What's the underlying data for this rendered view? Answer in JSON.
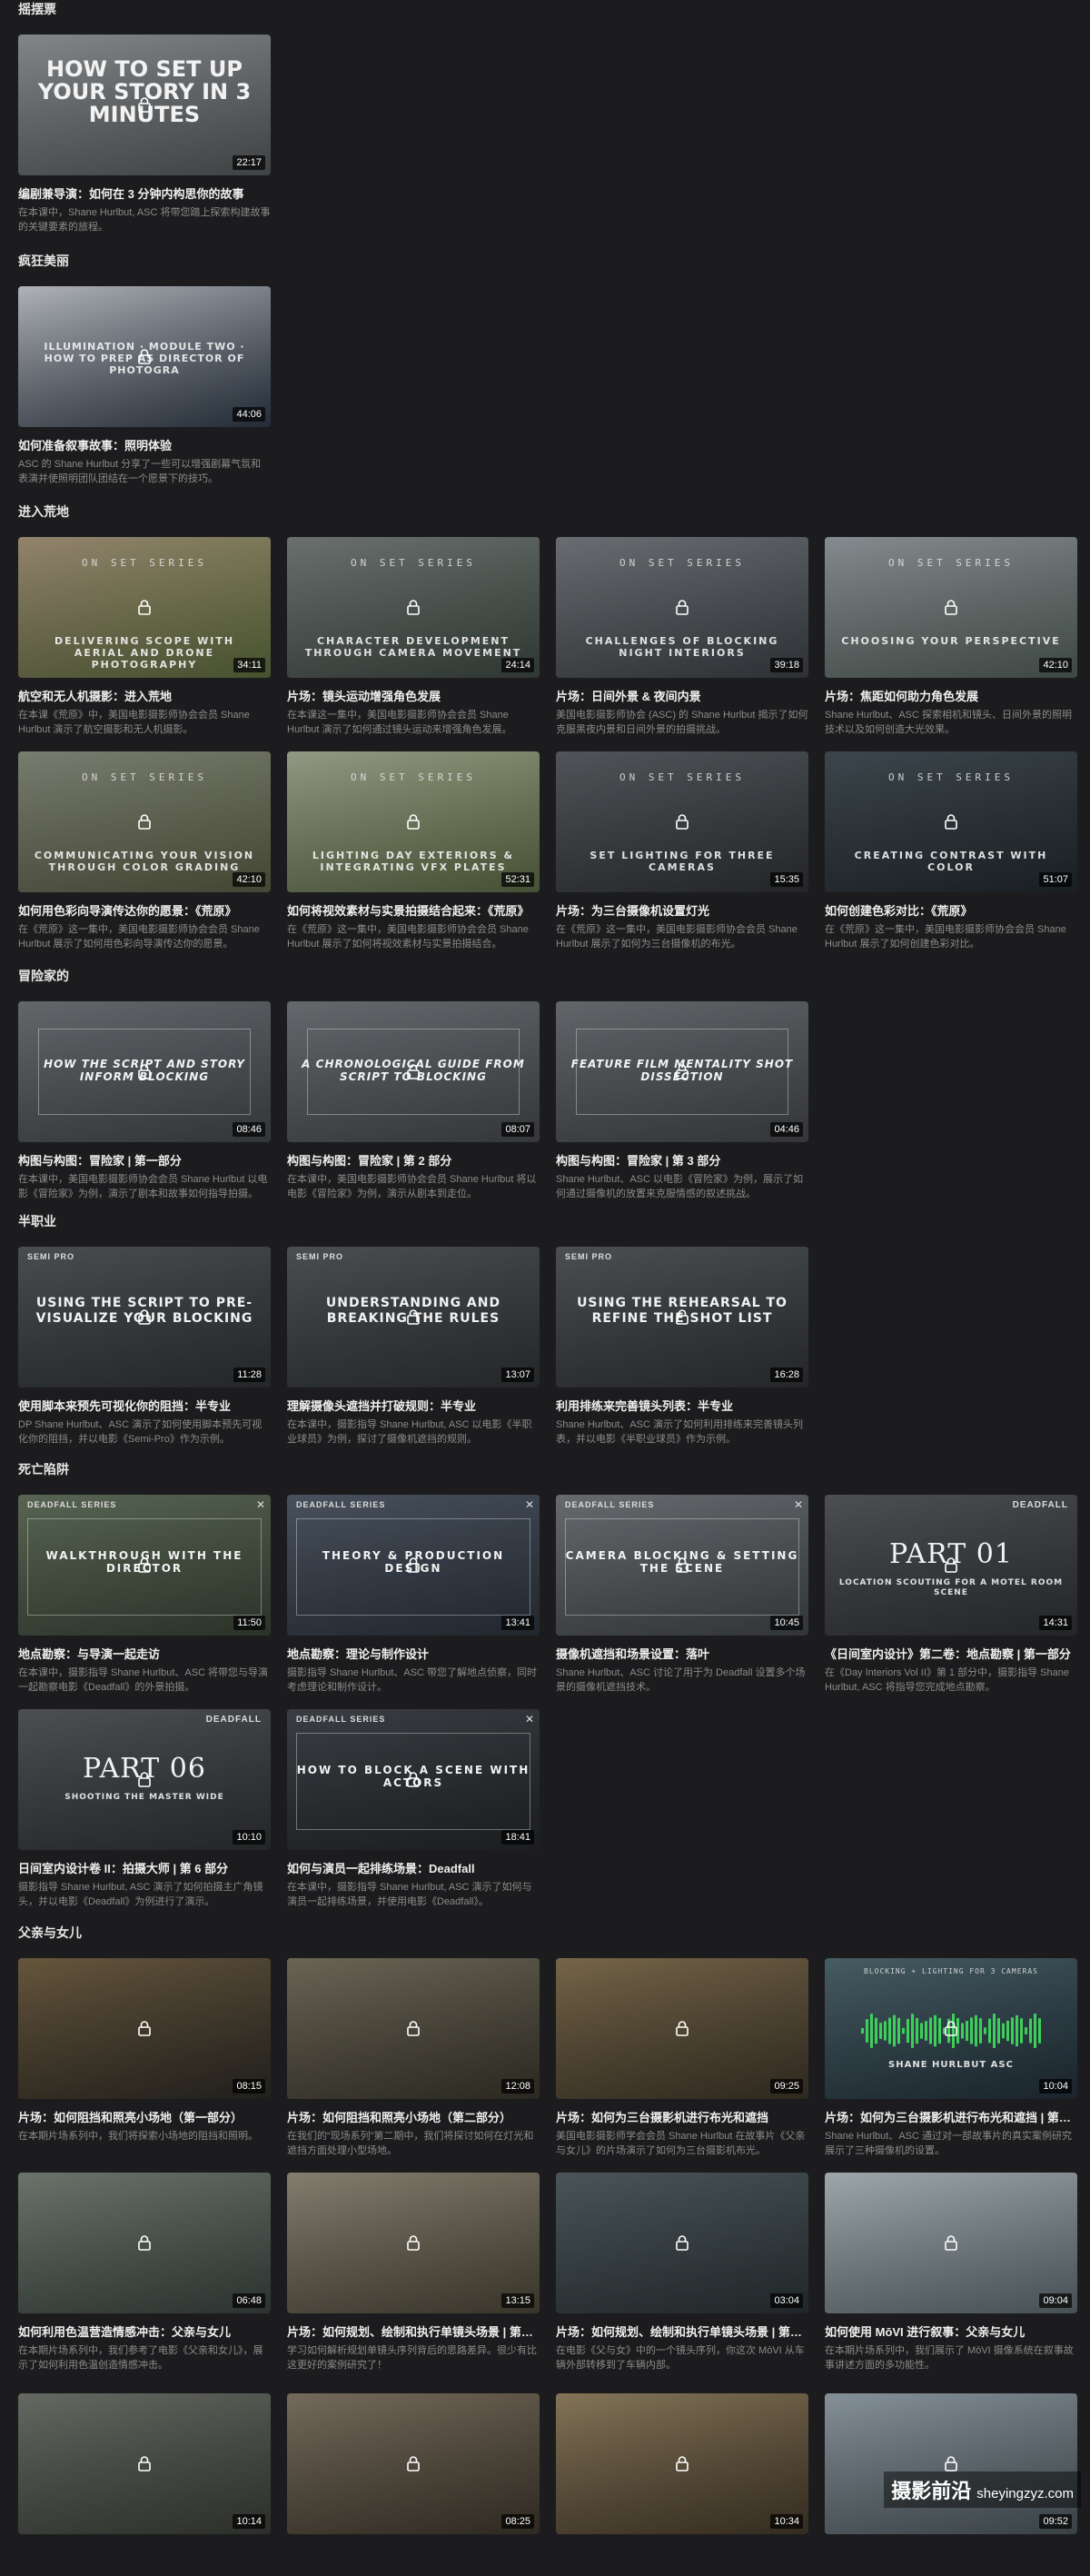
{
  "sections": [
    {
      "title": "摇摆票",
      "top": 0,
      "cards": [
        {
          "title": "编剧兼导演：如何在 3 分钟内构思你的故事",
          "desc": "在本课中，Shane Hurlbut, ASC 将带您踏上探索构建故事的关键要素的旅程。",
          "duration": "22:17",
          "thumb_text": "HOW TO SET UP YOUR STORY IN 3 MINUTES",
          "bg": [
            "#8a8d8f",
            "#55585b"
          ],
          "style": "big"
        }
      ]
    },
    {
      "title": "疯狂美丽",
      "top": 277,
      "cards": [
        {
          "title": "如何准备叙事故事：照明体验",
          "desc": "ASC 的 Shane Hurlbut 分享了一些可以增强剧幕气氛和表演并使照明团队团结在一个愿景下的技巧。",
          "duration": "44:06",
          "thumb_text": "ILLUMINATION · MODULE TWO · HOW TO PREP AS DIRECTOR OF PHOTOGRA",
          "bg": [
            "#b8bcc0",
            "#2f3a49"
          ],
          "style": "illum"
        }
      ]
    },
    {
      "title": "进入荒地",
      "top": 553,
      "cards": [
        {
          "title": "航空和无人机摄影：进入荒地",
          "desc": "在本课《荒原》中，美国电影摄影师协会会员 Shane Hurlbut 演示了航空摄影和无人机摄影。",
          "duration": "34:11",
          "series": "ON SET SERIES",
          "thumb_text": "DELIVERING SCOPE WITH AERIAL AND DRONE PHOTOGRAPHY",
          "bg": [
            "#9a8a72",
            "#5f6d3f"
          ],
          "style": "onset"
        },
        {
          "title": "片场：镜头运动增强角色发展",
          "desc": "在本课这一集中，美国电影摄影师协会会员 Shane Hurlbut 演示了如何通过镜头运动来增强角色发展。",
          "duration": "24:14",
          "series": "ON SET SERIES",
          "thumb_text": "CHARACTER DEVELOPMENT THROUGH CAMERA MOVEMENT",
          "bg": [
            "#707674",
            "#3f4a43"
          ],
          "style": "onset"
        },
        {
          "title": "片场：日间外景 & 夜间内景",
          "desc": "美国电影摄影师协会 (ASC) 的 Shane Hurlbut 揭示了如何克服黑夜内景和日间外景的拍摄挑战。",
          "duration": "39:18",
          "series": "ON SET SERIES",
          "thumb_text": "CHALLENGES OF BLOCKING NIGHT INTERIORS",
          "bg": [
            "#6f7377",
            "#3d4146"
          ],
          "style": "onset"
        },
        {
          "title": "片场：焦距如何助力角色发展",
          "desc": "Shane Hurlbut、ASC 探索相机和镜头、日间外景的照明技术以及如何创造大光效果。",
          "duration": "42:10",
          "series": "ON SET SERIES",
          "thumb_text": "CHOOSING YOUR PERSPECTIVE",
          "bg": [
            "#8c9296",
            "#53605a"
          ],
          "style": "onset"
        },
        {
          "title": "如何用色彩向导演传达你的愿景：《荒原》",
          "desc": "在《荒原》这一集中，美国电影摄影师协会会员 Shane Hurlbut 展示了如何用色彩向导演传达你的愿景。",
          "duration": "42:10",
          "series": "ON SET SERIES",
          "thumb_text": "COMMUNICATING YOUR VISION THROUGH COLOR GRADING",
          "bg": [
            "#7e8376",
            "#5a5e44"
          ],
          "style": "onset"
        },
        {
          "title": "如何将视效素材与实景拍摄结合起来：《荒原》",
          "desc": "在《荒原》这一集中，美国电影摄影师协会会员 Shane Hurlbut 展示了如何将视效素材与实景拍摄结合。",
          "duration": "52:31",
          "series": "ON SET SERIES",
          "thumb_text": "LIGHTING DAY EXTERIORS & INTEGRATING VFX PLATES",
          "bg": [
            "#9aa08a",
            "#5e6b45"
          ],
          "style": "onset"
        },
        {
          "title": "片场：为三台摄像机设置灯光",
          "desc": "在《荒原》这一集中，美国电影摄影师协会会员 Shane Hurlbut 展示了如何为三台摄像机的布光。",
          "duration": "15:35",
          "series": "ON SET SERIES",
          "thumb_text": "SET LIGHTING FOR THREE CAMERAS",
          "bg": [
            "#55595d",
            "#2f3236"
          ],
          "style": "onset"
        },
        {
          "title": "如何创建色彩对比：《荒原》",
          "desc": "在《荒原》这一集中，美国电影摄影师协会会员 Shane Hurlbut 展示了如何创建色彩对比。",
          "duration": "51:07",
          "series": "ON SET SERIES",
          "thumb_text": "CREATING CONTRAST WITH COLOR",
          "bg": [
            "#3f4a50",
            "#23292e"
          ],
          "style": "onset"
        }
      ]
    },
    {
      "title": "冒险家的",
      "top": 1064,
      "cards": [
        {
          "title": "构图与构图：冒险家 | 第一部分",
          "desc": "在本课中，美国电影摄影师协会会员 Shane Hurlbut 以电影《冒险家》为例，演示了剧本和故事如何指导拍摄。",
          "duration": "08:46",
          "thumb_text": "HOW THE SCRIPT AND STORY INFORM BLOCKING",
          "bg": [
            "#686c70",
            "#44484c"
          ],
          "style": "framed"
        },
        {
          "title": "构图与构图：冒险家 | 第 2 部分",
          "desc": "在本课中，美国电影摄影师协会会员 Shane Hurlbut 将以电影《冒险家》为例，演示从剧本到走位。",
          "duration": "08:07",
          "thumb_text": "A CHRONOLOGICAL GUIDE FROM SCRIPT TO BLOCKING",
          "bg": [
            "#6a6e72",
            "#46494d"
          ],
          "style": "framed"
        },
        {
          "title": "构图与构图：冒险家 | 第 3 部分",
          "desc": "Shane Hurlbut、ASC 以电影《冒险家》为例，展示了如何通过摄像机的放置来克服情感的叙述挑战。",
          "duration": "04:46",
          "thumb_text": "FEATURE FILM MENTALITY SHOT DISSECTION",
          "bg": [
            "#676b6f",
            "#44474b"
          ],
          "style": "framed"
        }
      ]
    },
    {
      "title": "半职业",
      "top": 1334,
      "cards": [
        {
          "title": "使用脚本来预先可视化你的阻挡：半专业",
          "desc": "DP Shane Hurlbut、ASC 演示了如何使用脚本预先可视化你的阻挡，并以电影《Semi-Pro》作为示例。",
          "duration": "11:28",
          "series": "SEMI PRO",
          "thumb_text": "USING THE SCRIPT TO PRE-VISUALIZE YOUR BLOCKING",
          "bg": [
            "#4d5154",
            "#303336"
          ],
          "style": "semi"
        },
        {
          "title": "理解摄像头遮挡并打破规则：半专业",
          "desc": "在本课中，摄影指导 Shane Hurlbut, ASC 以电影《半职业球员》为例，探讨了摄像机遮挡的规则。",
          "duration": "13:07",
          "series": "SEMI PRO",
          "thumb_text": "UNDERSTANDING AND BREAKING THE RULES",
          "bg": [
            "#4e5255",
            "#303336"
          ],
          "style": "semi"
        },
        {
          "title": "利用排练来完善镜头列表：半专业",
          "desc": "Shane Hurlbut、ASC 演示了如何利用排练来完善镜头列表，并以电影《半职业球员》作为示例。",
          "duration": "16:28",
          "series": "SEMI PRO",
          "thumb_text": "USING THE REHEARSAL TO REFINE THE SHOT LIST",
          "bg": [
            "#4f5356",
            "#303336"
          ],
          "style": "semi"
        }
      ]
    },
    {
      "title": "死亡陷阱",
      "top": 1607,
      "cards": [
        {
          "title": "地点勘察：与导演一起走访",
          "desc": "在本课中，摄影指导 Shane Hurlbut、ASC 将带您与导演一起勘察电影《Deadfall》的外景拍摄。",
          "duration": "11:50",
          "series": "DEADFALL SERIES",
          "thumb_text": "WALKTHROUGH WITH THE DIRECTOR",
          "bg": [
            "#5c6a58",
            "#3a4436"
          ],
          "style": "deadfall"
        },
        {
          "title": "地点勘察：理论与制作设计",
          "desc": "摄影指导 Shane Hurlbut、ASC 带您了解地点侦察，同时考虑理论和制作设计。",
          "duration": "13:41",
          "series": "DEADFALL SERIES",
          "thumb_text": "THEORY & PRODUCTION DESIGN",
          "bg": [
            "#4c5562",
            "#2d343d"
          ],
          "style": "deadfall"
        },
        {
          "title": "摄像机遮挡和场景设置：落叶",
          "desc": "Shane Hurlbut、ASC 讨论了用于为 Deadfall 设置多个场景的摄像机遮挡技术。",
          "duration": "10:45",
          "series": "DEADFALL SERIES",
          "thumb_text": "CAMERA BLOCKING & SETTING THE SCENE",
          "bg": [
            "#6c7074",
            "#43474b"
          ],
          "style": "deadfall"
        },
        {
          "title": "《日间室内设计》第二卷：地点勘察 | 第一部分",
          "desc": "在《Day Interiors Vol II》第 1 部分中，摄影指导 Shane Hurlbut, ASC 将指导您完成地点勘察。",
          "duration": "14:31",
          "series": "DEADFALL",
          "thumb_text": "PART 01",
          "thumb_sub": "LOCATION SCOUTING FOR A MOTEL ROOM SCENE",
          "bg": [
            "#505357",
            "#2f3235"
          ],
          "style": "part"
        },
        {
          "title": "日间室内设计卷 II：拍摄大师 | 第 6 部分",
          "desc": "摄影指导 Shane Hurlbut, ASC 演示了如何拍摄主广角镜头，并以电影《Deadfall》为例进行了演示。",
          "duration": "10:10",
          "series": "DEADFALL",
          "thumb_text": "PART 06",
          "thumb_sub": "SHOOTING THE MASTER WIDE",
          "bg": [
            "#505357",
            "#2f3235"
          ],
          "style": "part"
        },
        {
          "title": "如何与演员一起排练场景：Deadfall",
          "desc": "在本课中，摄影指导 Shane Hurlbut, ASC 演示了如何与演员一起排练场景，并使用电影《Deadfall》。",
          "duration": "18:41",
          "series": "DEADFALL SERIES",
          "thumb_text": "HOW TO BLOCK A SCENE WITH ACTORS",
          "bg": [
            "#3d4146",
            "#24272a"
          ],
          "style": "deadfall"
        }
      ]
    },
    {
      "title": "父亲与女儿",
      "top": 2117,
      "cards": [
        {
          "title": "片场：如何阻挡和照亮小场地（第一部分）",
          "desc": "在本期片场系列中，我们将探索小场地的阻挡和照明。",
          "duration": "08:15",
          "bg": [
            "#6b5a3f",
            "#2c2a25"
          ],
          "style": "plain"
        },
        {
          "title": "片场：如何阻挡和照亮小场地（第二部分）",
          "desc": "在我们的“现场系列”第二期中，我们将探讨如何在灯光和遮挡方面处理小型场地。",
          "duration": "12:08",
          "bg": [
            "#6f6a5a",
            "#3a362c"
          ],
          "style": "plain"
        },
        {
          "title": "片场：如何为三台摄影机进行布光和遮挡",
          "desc": "美国电影摄影师学会会员 Shane Hurlbut 在故事片《父亲与女儿》的片场演示了如何为三台摄影机布光。",
          "duration": "09:25",
          "bg": [
            "#7b6a4c",
            "#3d3528"
          ],
          "style": "plain"
        },
        {
          "title": "片场：如何为三台摄影机进行布光和遮挡 | 第二部分",
          "desc": "Shane Hurlbut、ASC 通过对一部故事片的真实案例研究展示了三种摄像机的设置。",
          "duration": "10:04",
          "series": "BLOCKING + LIGHTING FOR 3 CAMERAS",
          "thumb_text": "SHANE HURLBUT ASC",
          "bg": [
            "#4a6068",
            "#22303a"
          ],
          "style": "wave"
        },
        {
          "title": "如何利用色温营造情感冲击：父亲与女儿",
          "desc": "在本期片场系列中，我们参考了电影《父亲和女儿》，展示了如何利用色温创造情感冲击。",
          "duration": "06:48",
          "bg": [
            "#6f7a70",
            "#3a4440"
          ],
          "style": "plain"
        },
        {
          "title": "片场：如何规划、绘制和执行单镜头场景 | 第一部分",
          "desc": "学习如何解析规划单镜头序列背后的思路差异。很少有比这更好的案例研究了！",
          "duration": "13:15",
          "bg": [
            "#8a8475",
            "#4b4638"
          ],
          "style": "plain"
        },
        {
          "title": "片场：如何规划、绘制和执行单镜头场景 | 第二部分",
          "desc": "在电影《父与女》中的一个镜头序列，你这次 MōVI 从车辆外部转移到了车辆内部。",
          "duration": "03:04",
          "bg": [
            "#4e5a5e",
            "#2b3336"
          ],
          "style": "plain"
        },
        {
          "title": "如何使用 MōVI 进行叙事：父亲与女儿",
          "desc": "在本期片场系列中，我们展示了 MōVI 摄像系统在叙事故事讲述方面的多功能性。",
          "duration": "09:04",
          "bg": [
            "#a6b0b2",
            "#5f6b70"
          ],
          "style": "plain"
        }
      ]
    },
    {
      "title": "",
      "top": 2634,
      "cards": [
        {
          "title": "",
          "desc": "",
          "duration": "10:14",
          "bg": [
            "#6a6e66",
            "#3a3e38"
          ],
          "style": "plain"
        },
        {
          "title": "",
          "desc": "",
          "duration": "08:25",
          "bg": [
            "#7a7060",
            "#3e372c"
          ],
          "style": "plain"
        },
        {
          "title": "",
          "desc": "",
          "duration": "10:34",
          "bg": [
            "#8a7a5c",
            "#453a2a"
          ],
          "style": "plain"
        },
        {
          "title": "",
          "desc": "",
          "duration": "09:52",
          "bg": [
            "#8c98a0",
            "#4c575c"
          ],
          "style": "plain"
        }
      ]
    }
  ],
  "watermark": {
    "cn": "摄影前沿",
    "url": "sheyingzyz.com"
  },
  "colors": {
    "background": "#1c1c1e",
    "title_text": "#efefef",
    "desc_text": "#8b8b8b",
    "wave_green": "#3ecf5a"
  }
}
